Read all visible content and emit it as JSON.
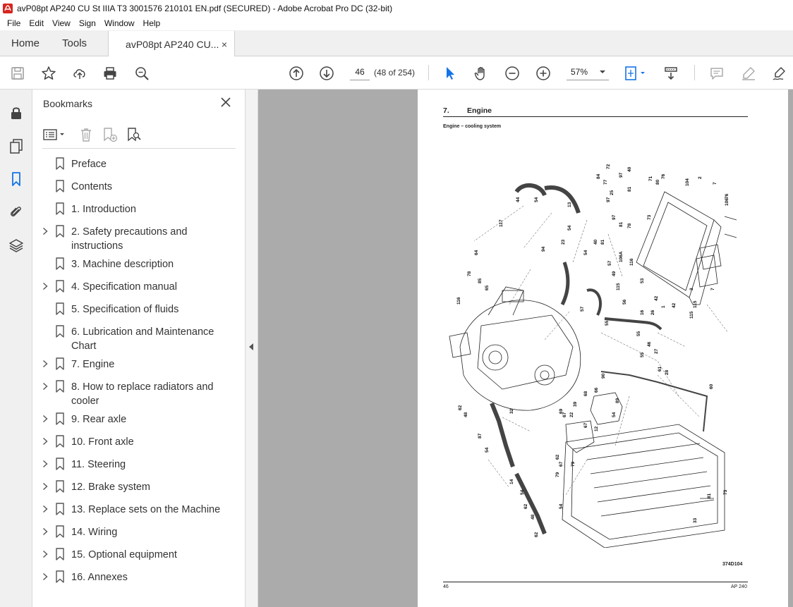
{
  "window": {
    "title": "avP08pt AP240 CU St IIIA T3 3001576 210101 EN.pdf (SECURED) - Adobe Acrobat Pro DC (32-bit)"
  },
  "menu": {
    "items": [
      "File",
      "Edit",
      "View",
      "Sign",
      "Window",
      "Help"
    ]
  },
  "tabs": {
    "home": "Home",
    "tools": "Tools",
    "document": "avP08pt AP240 CU...",
    "close": "×"
  },
  "toolbar": {
    "page_number": "46",
    "page_count": "(48 of 254)",
    "zoom": "57%"
  },
  "bookmarks": {
    "title": "Bookmarks",
    "close": "×",
    "items": [
      {
        "label": "Preface",
        "expandable": false
      },
      {
        "label": "Contents",
        "expandable": false
      },
      {
        "label": "1. Introduction",
        "expandable": false
      },
      {
        "label": "2. Safety precautions and instructions",
        "expandable": true
      },
      {
        "label": "3. Machine description",
        "expandable": false
      },
      {
        "label": "4. Specification manual",
        "expandable": true
      },
      {
        "label": "5. Specification of fluids",
        "expandable": false
      },
      {
        "label": "6. Lubrication and Maintenance Chart",
        "expandable": false
      },
      {
        "label": "7. Engine",
        "expandable": true
      },
      {
        "label": "8. How to replace radiators and cooler",
        "expandable": true
      },
      {
        "label": "9. Rear axle",
        "expandable": true
      },
      {
        "label": "10. Front axle",
        "expandable": true
      },
      {
        "label": "11. Steering",
        "expandable": true
      },
      {
        "label": "12. Brake system",
        "expandable": true
      },
      {
        "label": "13. Replace sets on the Machine",
        "expandable": true
      },
      {
        "label": "14. Wiring",
        "expandable": true
      },
      {
        "label": "15. Optional equipment",
        "expandable": true
      },
      {
        "label": "16. Annexes",
        "expandable": true
      }
    ]
  },
  "document_page": {
    "chapter_number": "7.",
    "chapter_title": "Engine",
    "subtitle": "Engine – cooling system",
    "figure_code": "374D104",
    "footer_page": "46",
    "footer_model": "AP 240",
    "part_callouts": [
      "72",
      "40",
      "97",
      "84",
      "77",
      "76",
      "104",
      "2",
      "7",
      "54",
      "44",
      "13",
      "97",
      "25",
      "81",
      "71",
      "80",
      "76",
      "106",
      "117",
      "54",
      "23",
      "97",
      "81",
      "78",
      "73",
      "64",
      "78",
      "85",
      "65",
      "94",
      "54",
      "40",
      "81",
      "57",
      "106A",
      "49",
      "116",
      "115",
      "56",
      "42",
      "3",
      "7",
      "116",
      "57",
      "53",
      "16",
      "26",
      "1",
      "42",
      "115",
      "115",
      "55",
      "55",
      "46",
      "55",
      "27",
      "61",
      "28",
      "60",
      "90",
      "66",
      "68",
      "89",
      "54",
      "62",
      "48",
      "87",
      "69",
      "67",
      "22",
      "39",
      "67",
      "12",
      "62",
      "54",
      "14",
      "79",
      "67",
      "79",
      "54",
      "62",
      "48",
      "54",
      "62",
      "33",
      "81",
      "73",
      "32"
    ]
  },
  "colors": {
    "accent_blue": "#1473e6",
    "doc_background": "#ababab",
    "panel_background": "#f0f0f0"
  }
}
